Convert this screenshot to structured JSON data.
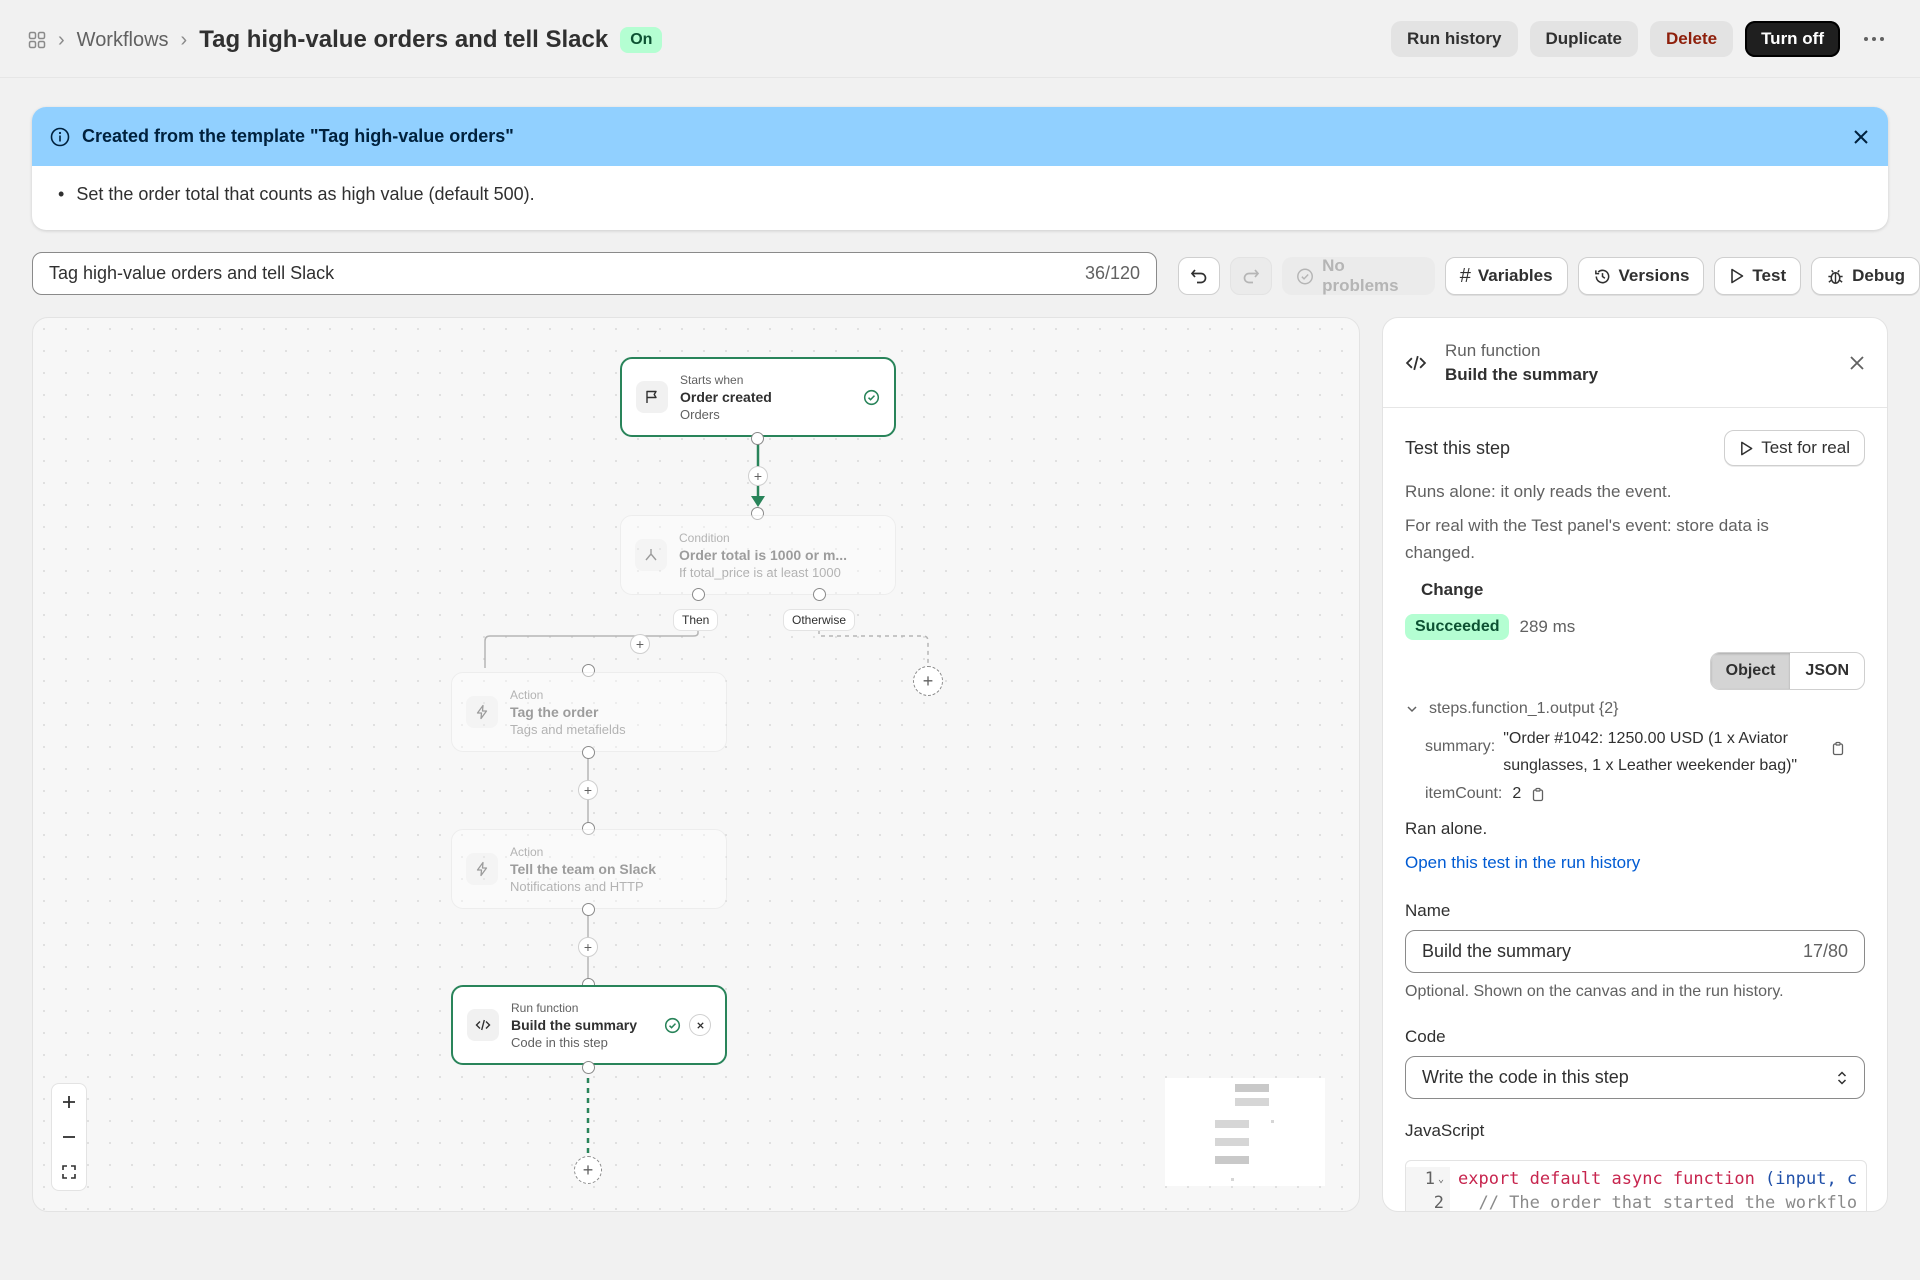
{
  "header": {
    "breadcrumb_root": "Workflows",
    "title": "Tag high-value orders and tell Slack",
    "status": "On",
    "actions": {
      "run_history": "Run history",
      "duplicate": "Duplicate",
      "delete": "Delete",
      "turn_off": "Turn off"
    }
  },
  "banner": {
    "title": "Created from the template \"Tag high-value orders\"",
    "items": [
      "Set the order total that counts as high value (default 500)."
    ]
  },
  "name_field": {
    "value": "Tag high-value orders and tell Slack",
    "count": "36/120"
  },
  "toolbar": {
    "no_problems": "No problems",
    "variables": "Variables",
    "versions": "Versions",
    "test": "Test",
    "debug": "Debug"
  },
  "canvas": {
    "trigger": {
      "kind": "Starts when",
      "title": "Order created",
      "sub": "Orders"
    },
    "condition": {
      "kind": "Condition",
      "title": "Order total is 1000 or m...",
      "sub": "If total_price is at least 1000"
    },
    "branch_then": "Then",
    "branch_otherwise": "Otherwise",
    "action1": {
      "kind": "Action",
      "title": "Tag the order",
      "sub": "Tags and metafields"
    },
    "action2": {
      "kind": "Action",
      "title": "Tell the team on Slack",
      "sub": "Notifications and HTTP"
    },
    "function": {
      "kind": "Run function",
      "title": "Build the summary",
      "sub": "Code in this step"
    }
  },
  "panel": {
    "kind": "Run function",
    "title": "Build the summary",
    "test_heading": "Test this step",
    "test_for_real": "Test for real",
    "runs_alone": "Runs alone: it only reads the event.",
    "for_real": "For real with the Test panel's event: store data is changed.",
    "change": "Change",
    "result_status": "Succeeded",
    "duration": "289 ms",
    "view_object": "Object",
    "view_json": "JSON",
    "output_root": "steps.function_1.output {2}",
    "summary_key": "summary:",
    "summary_val": "\"Order #1042: 1250.00 USD (1 x Aviator sunglasses, 1 x Leather weekender bag)\"",
    "itemcount_key": "itemCount:",
    "itemcount_val": "2",
    "ran_alone": "Ran alone.",
    "open_link": "Open this test in the run history",
    "name_label": "Name",
    "name_value": "Build the summary",
    "name_count": "17/80",
    "name_help": "Optional. Shown on the canvas and in the run history.",
    "code_label": "Code",
    "code_select": "Write the code in this step",
    "js_label": "JavaScript",
    "code_lines": [
      {
        "num": "1",
        "kw": "export default async function",
        "rest": " (input, c"
      },
      {
        "num": "2",
        "comment": "  // The order that started the workflo"
      }
    ]
  },
  "colors": {
    "accent_green": "#29845a",
    "badge_green": "#b4fed2",
    "banner_blue": "#91d0ff",
    "link_blue": "#005bd3"
  }
}
